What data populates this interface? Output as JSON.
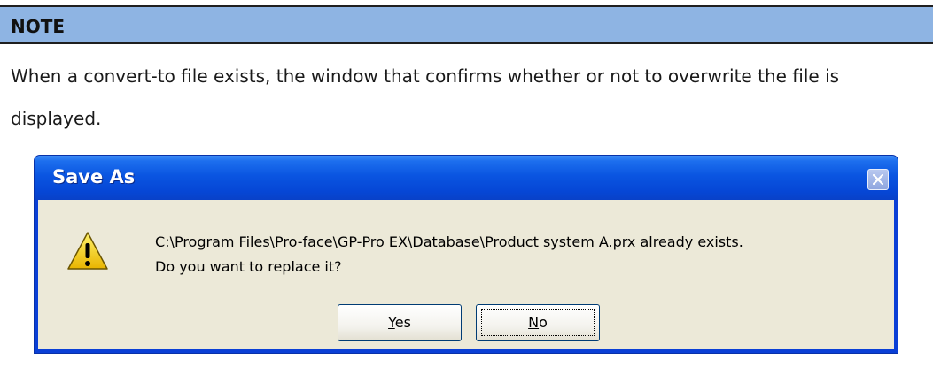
{
  "note": {
    "title": "NOTE",
    "text": "When a convert-to file exists, the window that confirms whether or not to overwrite the file is displayed."
  },
  "dialog": {
    "title": "Save As",
    "message_line1": "C:\\Program Files\\Pro-face\\GP-Pro EX\\Database\\Product system A.prx already exists.",
    "message_line2": "Do you want to replace it?",
    "yes_accel": "Y",
    "yes_rest": "es",
    "no_accel": "N",
    "no_rest": "o",
    "icon": "warning-icon",
    "close_icon": "close-icon",
    "colors": {
      "titlebar": "#0a55e1",
      "client": "#ece9d8",
      "note_header": "#8eb4e3"
    }
  }
}
